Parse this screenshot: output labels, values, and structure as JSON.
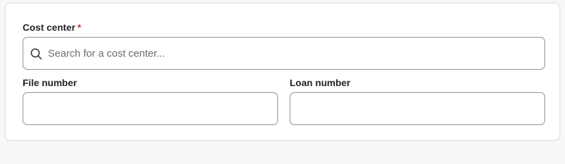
{
  "form": {
    "cost_center": {
      "label": "Cost center",
      "required_marker": "*",
      "placeholder": "Search for a cost center...",
      "value": "",
      "icon": "search-icon"
    },
    "file_number": {
      "label": "File number",
      "value": ""
    },
    "loan_number": {
      "label": "Loan number",
      "value": ""
    }
  },
  "colors": {
    "required": "#c0392b",
    "border": "#8e8f93",
    "card_border": "#d9d9dc",
    "background": "#f7f7f8"
  }
}
